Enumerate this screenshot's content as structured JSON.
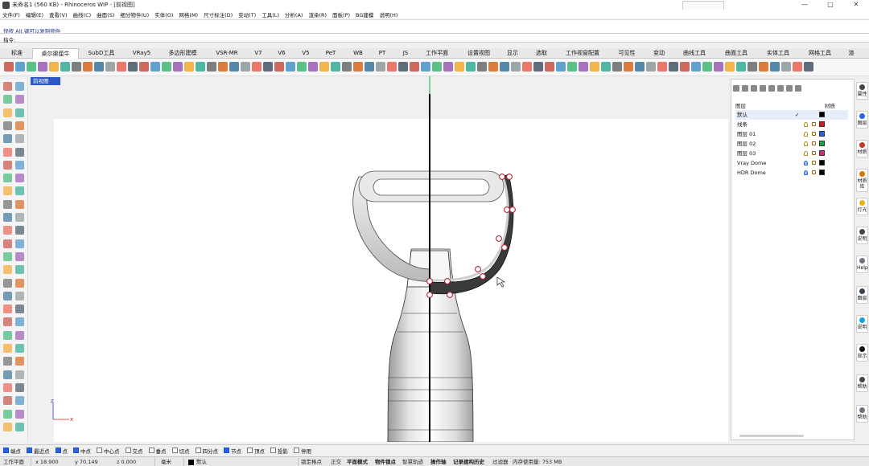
{
  "window": {
    "title": "未命名1 (560 KB) - Rhinoceros WIP - [前视图]",
    "controls": [
      "—",
      "□",
      "✕"
    ]
  },
  "menu": [
    "文件(F)",
    "编辑(E)",
    "查看(V)",
    "曲线(C)",
    "曲面(S)",
    "细分物件(U)",
    "实体(O)",
    "网格(M)",
    "尺寸标注(D)",
    "变动(T)",
    "工具(L)",
    "分析(A)",
    "渲染(R)",
    "面板(P)",
    "BG建模",
    "说明(H)"
  ],
  "command": {
    "history": "快按 Alt 键可以复制物件",
    "prompt_label": "指令:",
    "value": ""
  },
  "tabs": [
    "标准",
    "桌尔渠厘牛",
    "SubD工具",
    "VRay5",
    "多边形建模",
    "VSR-MR",
    "V7",
    "V6",
    "V5",
    "PeT",
    "WB",
    "PT",
    "JS",
    "工作平面",
    "设置视图",
    "显示",
    "选取",
    "工作视窗配置",
    "可见性",
    "变动",
    "曲线工具",
    "曲面工具",
    "实体工具",
    "网格工具",
    "渲"
  ],
  "active_tab": 1,
  "viewport": {
    "label": "前视图",
    "axis_x": "x",
    "axis_z": "z"
  },
  "layers": {
    "header_name": "图层",
    "header_material": "材质",
    "items": [
      {
        "name": "默认",
        "current": "✓",
        "color": "#000000"
      },
      {
        "name": "线条",
        "current": "",
        "color": "#d31b1b"
      },
      {
        "name": "图层 01",
        "current": "",
        "color": "#2563eb"
      },
      {
        "name": "图层 02",
        "current": "",
        "color": "#16a34a"
      },
      {
        "name": "图层 03",
        "current": "",
        "color": "#db2777"
      },
      {
        "name": "Vray Dome",
        "current": "",
        "color": "#000000"
      },
      {
        "name": "HDR Dome",
        "current": "",
        "color": "#000000"
      }
    ]
  },
  "side_tabs": [
    "属性",
    "图层",
    "材质",
    "材质库",
    "灯光",
    "说明",
    "Help",
    "图层",
    "说明",
    "显示",
    "帮助",
    "帮助"
  ],
  "snaps": [
    {
      "label": "端点",
      "on": true
    },
    {
      "label": "最近点",
      "on": true
    },
    {
      "label": "点",
      "on": true
    },
    {
      "label": "中点",
      "on": true
    },
    {
      "label": "中心点",
      "on": false
    },
    {
      "label": "交点",
      "on": false
    },
    {
      "label": "垂点",
      "on": false
    },
    {
      "label": "切点",
      "on": false
    },
    {
      "label": "四分点",
      "on": false
    },
    {
      "label": "节点",
      "on": true
    },
    {
      "label": "顶点",
      "on": false
    },
    {
      "label": "投影",
      "on": false
    },
    {
      "label": "停用",
      "on": false
    }
  ],
  "status": {
    "cplane": "工作平面",
    "x": "x 18.900",
    "y": "y 70.149",
    "z": "z 0.000",
    "units": "毫米",
    "layer": "默认",
    "toggles": [
      "锁定格点",
      "正交",
      "平面模式",
      "物件锁点",
      "智慧轨迹",
      "操作轴",
      "记录建构历史",
      "过滤器"
    ],
    "memory": "内存使用量: 753 MB"
  }
}
